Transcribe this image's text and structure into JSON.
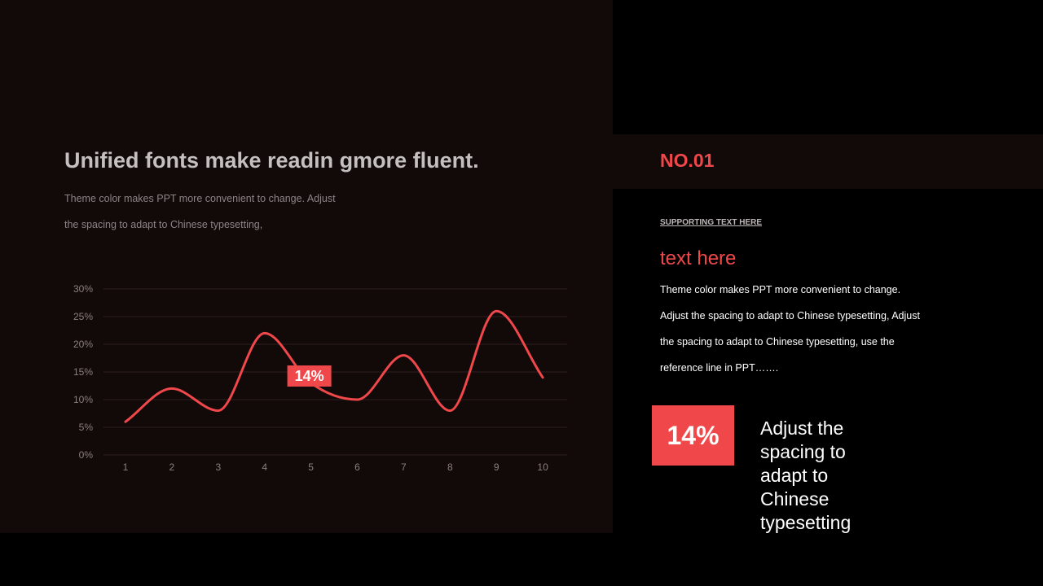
{
  "slide": {
    "headline": "Unified fonts make readin gmore fluent.",
    "description_lines": [
      "Theme color makes PPT more convenient to change. Adjust",
      "the spacing to adapt to Chinese typesetting,"
    ]
  },
  "sidebar": {
    "number_label": "NO.01",
    "supporting_text": "SUPPORTING TEXT HERE",
    "heading": "text here",
    "body_lines": [
      "Theme color makes PPT more convenient to change.",
      "Adjust the spacing to adapt to Chinese typesetting, Adjust",
      "the spacing to adapt to Chinese typesetting, use the",
      "reference line in PPT……."
    ],
    "badge_value": "14%",
    "badge_caption": "Adjust the spacing to adapt to Chinese typesetting"
  },
  "colors": {
    "accent": "#f0484a",
    "panel": "#120909",
    "background": "#000000"
  },
  "chart_data": {
    "type": "line",
    "title": "",
    "xlabel": "",
    "ylabel": "",
    "categories": [
      "1",
      "2",
      "3",
      "4",
      "5",
      "6",
      "7",
      "8",
      "9",
      "10"
    ],
    "series": [
      {
        "values": [
          6,
          12,
          8,
          22,
          13,
          10,
          18,
          8,
          26,
          14
        ]
      }
    ],
    "ylim": [
      0,
      30
    ],
    "yticks": [
      "0%",
      "5%",
      "10%",
      "15%",
      "20%",
      "25%",
      "30%"
    ],
    "smooth": true,
    "grid": true,
    "legend": "none",
    "annotation": {
      "category": "5",
      "text": "14%"
    }
  }
}
